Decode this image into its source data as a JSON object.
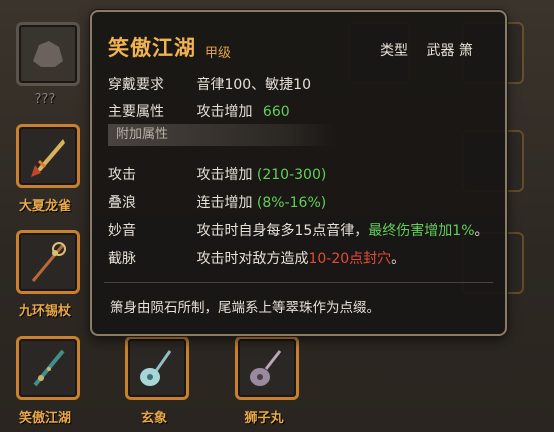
{
  "slots": {
    "unknown_label": "???",
    "items": [
      {
        "label": "大夏龙雀"
      },
      {
        "label": "九环锡杖"
      },
      {
        "label": "笑傲江湖"
      },
      {
        "label": "玄象"
      },
      {
        "label": "狮子丸"
      }
    ]
  },
  "tooltip": {
    "name": "笑傲江湖",
    "grade": "甲级",
    "type_label": "类型",
    "type_value": "武器 箫",
    "requirement_label": "穿戴要求",
    "requirement_value": "音律100、敏捷10",
    "main_attr_label": "主要属性",
    "main_attr_text": "攻击增加",
    "main_attr_value": "660",
    "extra_section": "附加属性",
    "extras": [
      {
        "key": "攻击",
        "text": "攻击增加",
        "value": "(210-300)"
      },
      {
        "key": "叠浪",
        "text": "连击增加",
        "value": "(8%-16%)"
      },
      {
        "key": "妙音",
        "text": "攻击时自身每多15点音律，",
        "highlight": "最终伤害增加1%",
        "tail": "。"
      },
      {
        "key": "截脉",
        "text": "攻击时对敌方造成",
        "highlight": "10-20点封穴",
        "tail": "。"
      }
    ],
    "description": "箫身由陨石所制，尾端系上等翠珠作为点缀。"
  },
  "colors": {
    "accent": "#f1b251",
    "green": "#62cf5a",
    "red": "#e24a3a",
    "slot_border": "#c9812f"
  }
}
